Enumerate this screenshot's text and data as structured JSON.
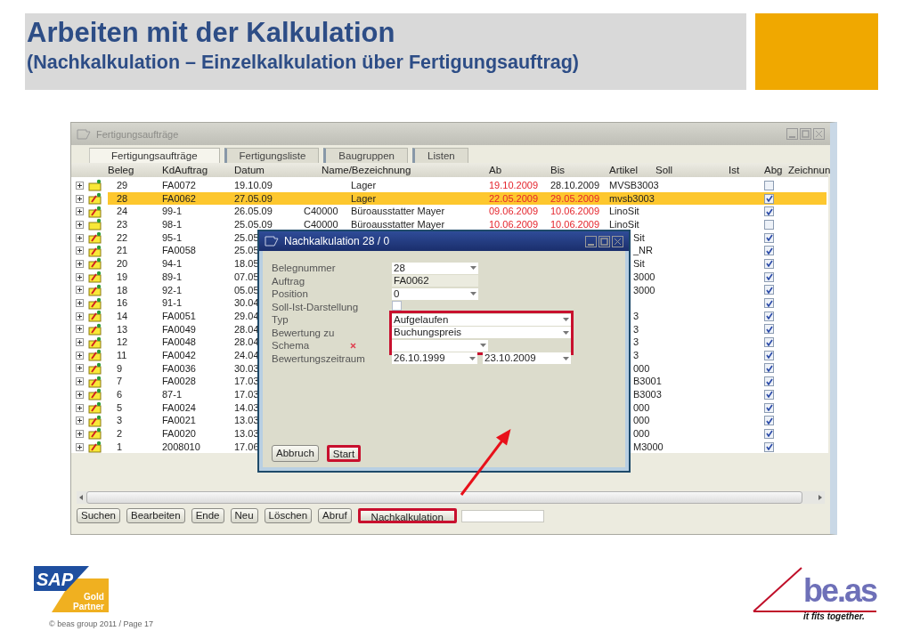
{
  "slide": {
    "title": "Arbeiten mit der Kalkulation",
    "subtitle": "(Nachkalkulation – Einzelkalkulation über Fertigungsauftrag)"
  },
  "window": {
    "title": "Fertigungsaufträge",
    "tabs": [
      {
        "label": "Fertigungsaufträge",
        "selected": true
      },
      {
        "label": "Fertigungsliste",
        "selected": false
      },
      {
        "label": "Baugruppen",
        "selected": false
      },
      {
        "label": "Listen",
        "selected": false
      }
    ],
    "table": {
      "columns": [
        "Beleg",
        "KdAuftrag",
        "Datum",
        "Name/Bezeichnung",
        "Ab",
        "Bis",
        "Artikel",
        "Soll",
        "Ist",
        "Abg",
        "Zeichnun"
      ],
      "rows": [
        {
          "kind": "folder",
          "selected": false,
          "covered": false,
          "beleg": "29",
          "kdauftrag": "FA0072",
          "datum": "19.10.09",
          "name": "Lager",
          "ab": "19.10.2009",
          "ab_late": true,
          "bis": "28.10.2009",
          "bis_late": false,
          "artikel": "MVSB3003",
          "abg": false
        },
        {
          "kind": "edit",
          "selected": true,
          "covered": false,
          "beleg": "28",
          "kdauftrag": "FA0062",
          "datum": "27.05.09",
          "name": "Lager",
          "ab": "22.05.2009",
          "ab_late": true,
          "bis": "29.05.2009",
          "bis_late": true,
          "artikel": "mvsb3003",
          "abg": true
        },
        {
          "kind": "edit",
          "selected": false,
          "covered": false,
          "beleg": "24",
          "kdauftrag": "99-1",
          "datum": "26.05.09",
          "column_4": "C40000",
          "name": "Büroausstatter Mayer",
          "ab": "09.06.2009",
          "ab_late": true,
          "bis": "10.06.2009",
          "bis_late": true,
          "artikel": "LinoSit",
          "abg": true
        },
        {
          "kind": "folder",
          "selected": false,
          "covered": false,
          "beleg": "23",
          "kdauftrag": "98-1",
          "datum": "25.05.09",
          "column_4": "C40000",
          "name": "Büroausstatter Mayer",
          "ab": "10.06.2009",
          "ab_late": true,
          "bis": "10.06.2009",
          "bis_late": true,
          "artikel": "LinoSit",
          "abg": false
        },
        {
          "kind": "edit",
          "selected": false,
          "covered": true,
          "beleg": "22",
          "kdauftrag": "95-1",
          "datum": "25.05",
          "artikel": "Sit",
          "abg": true
        },
        {
          "kind": "edit",
          "selected": false,
          "covered": true,
          "beleg": "21",
          "kdauftrag": "FA0058",
          "datum": "25.05",
          "artikel": "_NR",
          "abg": true
        },
        {
          "kind": "edit",
          "selected": false,
          "covered": true,
          "beleg": "20",
          "kdauftrag": "94-1",
          "datum": "18.05",
          "artikel": "Sit",
          "abg": true
        },
        {
          "kind": "edit",
          "selected": false,
          "covered": true,
          "beleg": "19",
          "kdauftrag": "89-1",
          "datum": "07.05",
          "artikel": "3000",
          "abg": true
        },
        {
          "kind": "edit",
          "selected": false,
          "covered": true,
          "beleg": "18",
          "kdauftrag": "92-1",
          "datum": "05.05",
          "artikel": "3000",
          "abg": true
        },
        {
          "kind": "edit",
          "selected": false,
          "covered": true,
          "beleg": "16",
          "kdauftrag": "91-1",
          "datum": "30.04",
          "abg": true
        },
        {
          "kind": "edit",
          "selected": false,
          "covered": true,
          "beleg": "14",
          "kdauftrag": "FA0051",
          "datum": "29.04",
          "artikel": "3",
          "abg": true
        },
        {
          "kind": "edit",
          "selected": false,
          "covered": true,
          "beleg": "13",
          "kdauftrag": "FA0049",
          "datum": "28.04",
          "artikel": "3",
          "abg": true
        },
        {
          "kind": "edit",
          "selected": false,
          "covered": true,
          "beleg": "12",
          "kdauftrag": "FA0048",
          "datum": "28.04",
          "artikel": "3",
          "abg": true
        },
        {
          "kind": "edit",
          "selected": false,
          "covered": true,
          "beleg": "11",
          "kdauftrag": "FA0042",
          "datum": "24.04",
          "artikel": "3",
          "abg": true
        },
        {
          "kind": "edit",
          "selected": false,
          "covered": true,
          "beleg": "9",
          "kdauftrag": "FA0036",
          "datum": "30.03",
          "artikel": "000",
          "abg": true
        },
        {
          "kind": "edit",
          "selected": false,
          "covered": true,
          "beleg": "7",
          "kdauftrag": "FA0028",
          "datum": "17.03",
          "artikel": "B3001",
          "abg": true
        },
        {
          "kind": "edit",
          "selected": false,
          "covered": true,
          "beleg": "6",
          "kdauftrag": "87-1",
          "datum": "17.03",
          "artikel": "B3003",
          "abg": true
        },
        {
          "kind": "edit",
          "selected": false,
          "covered": true,
          "beleg": "5",
          "kdauftrag": "FA0024",
          "datum": "14.03",
          "artikel": "000",
          "abg": true
        },
        {
          "kind": "edit",
          "selected": false,
          "covered": true,
          "beleg": "3",
          "kdauftrag": "FA0021",
          "datum": "13.03",
          "artikel": "000",
          "abg": true
        },
        {
          "kind": "edit",
          "selected": false,
          "covered": true,
          "beleg": "2",
          "kdauftrag": "FA0020",
          "datum": "13.03",
          "artikel": "000",
          "abg": true
        },
        {
          "kind": "edit",
          "selected": false,
          "covered": true,
          "beleg": "1",
          "kdauftrag": "2008010",
          "datum": "17.06",
          "artikel": "M3000",
          "abg": true
        }
      ]
    },
    "buttons": [
      {
        "label": "Suchen",
        "highlighted": false
      },
      {
        "label": "Bearbeiten",
        "highlighted": false
      },
      {
        "label": "Ende",
        "highlighted": false
      },
      {
        "label": "Neu",
        "highlighted": false
      },
      {
        "label": "Löschen",
        "highlighted": false
      },
      {
        "label": "Abruf",
        "highlighted": false
      },
      {
        "label": "Nachkalkulation",
        "highlighted": true
      }
    ]
  },
  "dialog": {
    "title": "Nachkalkulation 28 / 0",
    "fields": [
      {
        "label": "Belegnummer",
        "kind": "select",
        "value": "28"
      },
      {
        "label": "Auftrag",
        "kind": "readonly",
        "value": "FA0062"
      },
      {
        "label": "Position",
        "kind": "select",
        "value": "0"
      },
      {
        "label": "Soll-Ist-Darstellung",
        "kind": "checkbox",
        "checked": false
      },
      {
        "label": "Typ",
        "kind": "select",
        "value": "Aufgelaufen",
        "highlighted": true
      },
      {
        "label": "Bewertung zu",
        "kind": "select",
        "value": "Buchungspreis",
        "highlighted": true
      },
      {
        "label": "Schema",
        "kind": "select",
        "highlighted": true,
        "required": true
      },
      {
        "label": "Bewertungszeitraum",
        "kind": "range",
        "from": "26.10.1999",
        "to": "23.10.2009"
      }
    ],
    "buttons": [
      {
        "label": "Abbruch",
        "highlighted": false
      },
      {
        "label": "Start",
        "highlighted": true
      }
    ]
  },
  "footer": {
    "partner_logo": {
      "brand": "SAP",
      "badge": [
        "Gold",
        "Partner"
      ]
    },
    "copyright": "© beas group 2011 / Page 17",
    "company_logo": {
      "name": "be.as",
      "tagline": "it fits together."
    }
  }
}
